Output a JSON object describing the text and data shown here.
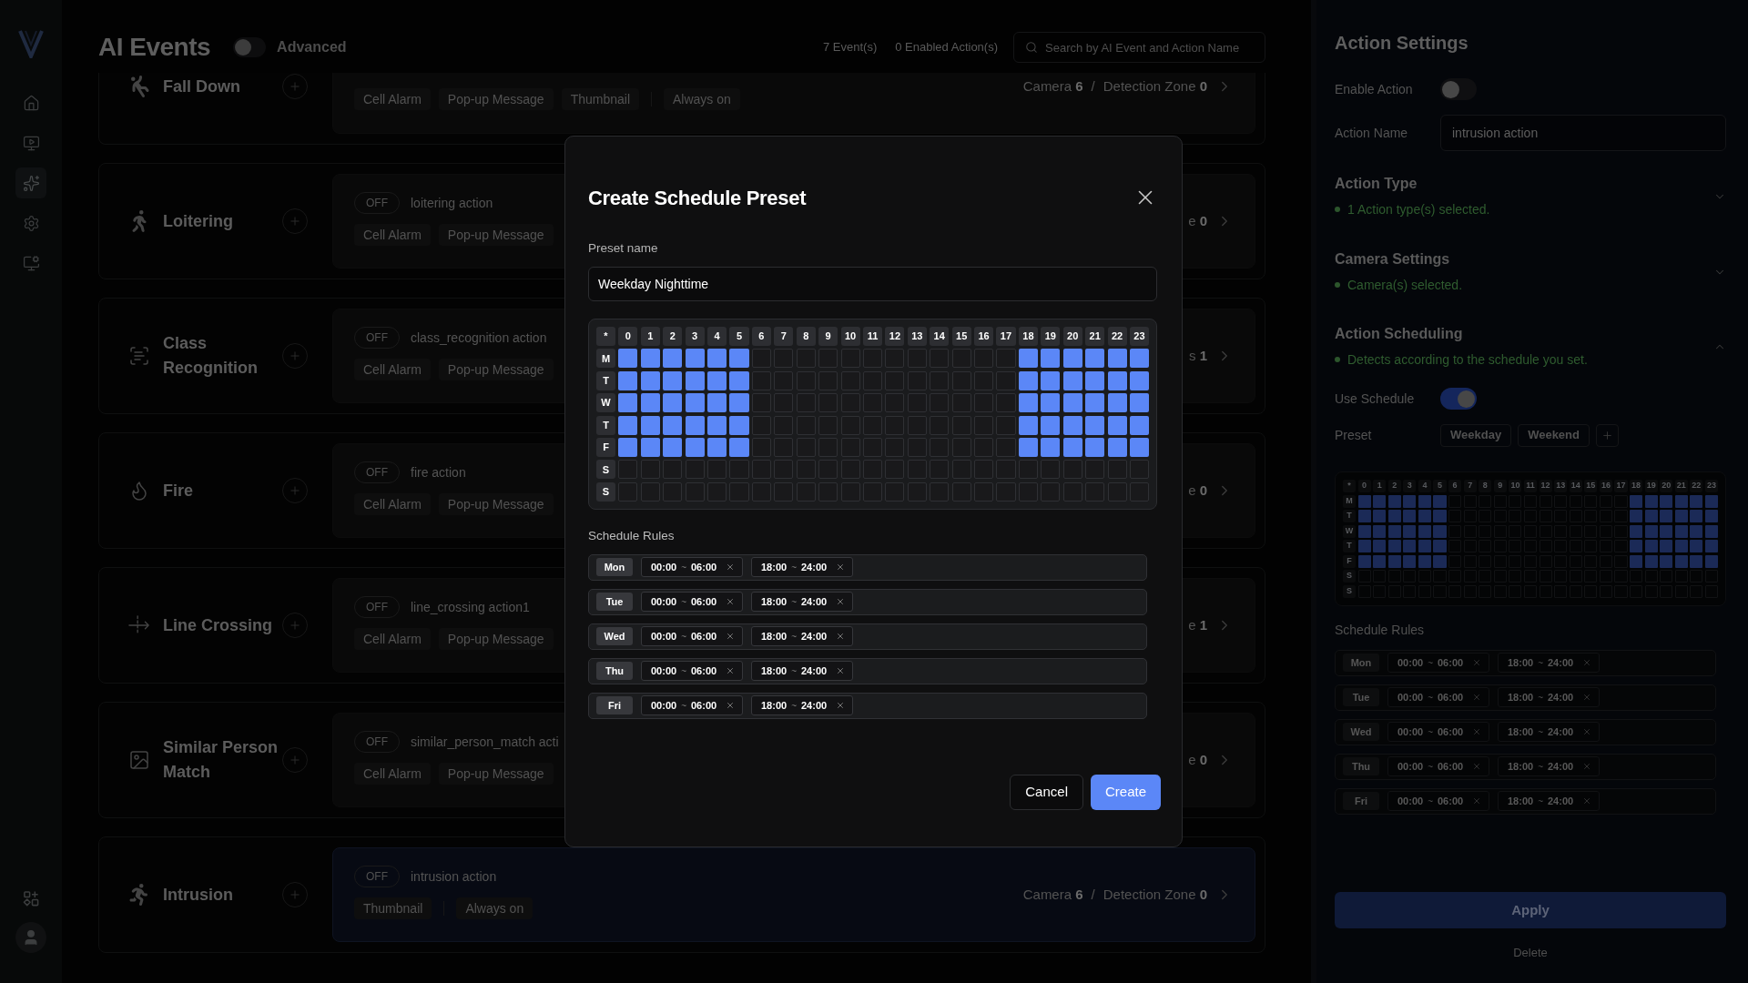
{
  "sidebar": {
    "nav": [
      {
        "selected": false
      },
      {
        "selected": false
      },
      {
        "selected": true
      },
      {
        "selected": false
      },
      {
        "selected": false
      }
    ]
  },
  "header": {
    "title": "AI Events",
    "advanced": {
      "label": "Advanced",
      "on": false
    },
    "event_count": "7 Event(s)",
    "enabled_count": "0 Enabled Action(s)",
    "search": {
      "placeholder": "Search by AI Event and Action Name"
    }
  },
  "events": [
    {
      "name": "Fall Down",
      "action": {
        "selected": false,
        "chips": [
          "Cell Alarm",
          "Pop-up Message",
          "Thumbnail"
        ],
        "schedule": "Always on",
        "summary": [
          "Camera **6**",
          "/",
          "Detection Zone **0**"
        ]
      }
    },
    {
      "name": "Loitering",
      "action": {
        "selected": false,
        "status": "OFF",
        "name": "loitering action",
        "chips": [
          "Cell Alarm",
          "Pop-up Message"
        ],
        "summary": [
          "e **0**"
        ]
      }
    },
    {
      "name": "Class Recognition",
      "action": {
        "selected": false,
        "status": "OFF",
        "name": "class_recognition action",
        "chips": [
          "Cell Alarm",
          "Pop-up Message"
        ],
        "summary": [
          "s **1**"
        ]
      }
    },
    {
      "name": "Fire",
      "action": {
        "selected": false,
        "status": "OFF",
        "name": "fire action",
        "chips": [
          "Cell Alarm",
          "Pop-up Message"
        ],
        "summary": [
          "e **0**"
        ]
      }
    },
    {
      "name": "Line Crossing",
      "action": {
        "selected": false,
        "status": "OFF",
        "name": "line_crossing action1",
        "chips": [
          "Cell Alarm",
          "Pop-up Message"
        ],
        "summary": [
          "e **1**"
        ]
      }
    },
    {
      "name": "Similar Person Match",
      "action": {
        "selected": false,
        "status": "OFF",
        "name": "similar_person_match acti",
        "chips": [
          "Cell Alarm",
          "Pop-up Message"
        ],
        "summary": [
          "e **0**"
        ]
      }
    },
    {
      "name": "Intrusion",
      "action": {
        "selected": true,
        "status": "OFF",
        "name": "intrusion action",
        "chips": [
          "Thumbnail"
        ],
        "schedule": "Always on",
        "summary": [
          "Camera **6**",
          "/",
          "Detection Zone **0**"
        ]
      }
    }
  ],
  "settings": {
    "title": "Action Settings",
    "enable_action": {
      "label": "Enable Action",
      "on": false
    },
    "action_name": {
      "label": "Action Name",
      "value": "intrusion action"
    },
    "sections": [
      {
        "title": "Action Type",
        "status": "1 Action type(s) selected.",
        "expanded": false
      },
      {
        "title": "Camera Settings",
        "status": "Camera(s) selected.",
        "expanded": false
      },
      {
        "title": "Action Scheduling",
        "status": "Detects according to the schedule you set.",
        "expanded": true,
        "use_schedule": {
          "label": "Use Schedule",
          "on": true
        },
        "preset": {
          "label": "Preset",
          "options": [
            "Weekday",
            "Weekend"
          ]
        },
        "grid": {
          "corner": "*",
          "hours": [
            "0",
            "1",
            "2",
            "3",
            "4",
            "5",
            "6",
            "7",
            "8",
            "9",
            "10",
            "11",
            "12",
            "13",
            "14",
            "15",
            "16",
            "17",
            "18",
            "19",
            "20",
            "21",
            "22",
            "23"
          ],
          "rows": [
            {
              "day": "M",
              "cells": [
                true,
                true,
                true,
                true,
                true,
                true,
                false,
                false,
                false,
                false,
                false,
                false,
                false,
                false,
                false,
                false,
                false,
                false,
                true,
                true,
                true,
                true,
                true,
                true
              ]
            },
            {
              "day": "T",
              "cells": [
                true,
                true,
                true,
                true,
                true,
                true,
                false,
                false,
                false,
                false,
                false,
                false,
                false,
                false,
                false,
                false,
                false,
                false,
                true,
                true,
                true,
                true,
                true,
                true
              ]
            },
            {
              "day": "W",
              "cells": [
                true,
                true,
                true,
                true,
                true,
                true,
                false,
                false,
                false,
                false,
                false,
                false,
                false,
                false,
                false,
                false,
                false,
                false,
                true,
                true,
                true,
                true,
                true,
                true
              ]
            },
            {
              "day": "T",
              "cells": [
                true,
                true,
                true,
                true,
                true,
                true,
                false,
                false,
                false,
                false,
                false,
                false,
                false,
                false,
                false,
                false,
                false,
                false,
                true,
                true,
                true,
                true,
                true,
                true
              ]
            },
            {
              "day": "F",
              "cells": [
                true,
                true,
                true,
                true,
                true,
                true,
                false,
                false,
                false,
                false,
                false,
                false,
                false,
                false,
                false,
                false,
                false,
                false,
                true,
                true,
                true,
                true,
                true,
                true
              ]
            },
            {
              "day": "S",
              "cells": [
                false,
                false,
                false,
                false,
                false,
                false,
                false,
                false,
                false,
                false,
                false,
                false,
                false,
                false,
                false,
                false,
                false,
                false,
                false,
                false,
                false,
                false,
                false,
                false
              ]
            },
            {
              "day": "S",
              "cells": [
                false,
                false,
                false,
                false,
                false,
                false,
                false,
                false,
                false,
                false,
                false,
                false,
                false,
                false,
                false,
                false,
                false,
                false,
                false,
                false,
                false,
                false,
                false,
                false
              ]
            }
          ]
        },
        "rules_label": "Schedule Rules",
        "rules": [
          {
            "day": "Mon",
            "ranges": [
              {
                "start": "00:00",
                "separator": "~",
                "end": "06:00"
              },
              {
                "start": "18:00",
                "separator": "~",
                "end": "24:00"
              }
            ]
          },
          {
            "day": "Tue",
            "ranges": [
              {
                "start": "00:00",
                "separator": "~",
                "end": "06:00"
              },
              {
                "start": "18:00",
                "separator": "~",
                "end": "24:00"
              }
            ]
          },
          {
            "day": "Wed",
            "ranges": [
              {
                "start": "00:00",
                "separator": "~",
                "end": "06:00"
              },
              {
                "start": "18:00",
                "separator": "~",
                "end": "24:00"
              }
            ]
          },
          {
            "day": "Thu",
            "ranges": [
              {
                "start": "00:00",
                "separator": "~",
                "end": "06:00"
              },
              {
                "start": "18:00",
                "separator": "~",
                "end": "24:00"
              }
            ]
          },
          {
            "day": "Fri",
            "ranges": [
              {
                "start": "00:00",
                "separator": "~",
                "end": "06:00"
              },
              {
                "start": "18:00",
                "separator": "~",
                "end": "24:00"
              }
            ]
          }
        ]
      }
    ],
    "apply": "Apply",
    "delete": "Delete"
  },
  "modal": {
    "title": "Create Schedule Preset",
    "preset": {
      "label": "Preset name",
      "value": "Weekday Nighttime"
    },
    "grid": {
      "corner": "*",
      "hours": [
        "0",
        "1",
        "2",
        "3",
        "4",
        "5",
        "6",
        "7",
        "8",
        "9",
        "10",
        "11",
        "12",
        "13",
        "14",
        "15",
        "16",
        "17",
        "18",
        "19",
        "20",
        "21",
        "22",
        "23"
      ],
      "rows": [
        {
          "day": "M",
          "cells": [
            true,
            true,
            true,
            true,
            true,
            true,
            false,
            false,
            false,
            false,
            false,
            false,
            false,
            false,
            false,
            false,
            false,
            false,
            true,
            true,
            true,
            true,
            true,
            true
          ]
        },
        {
          "day": "T",
          "cells": [
            true,
            true,
            true,
            true,
            true,
            true,
            false,
            false,
            false,
            false,
            false,
            false,
            false,
            false,
            false,
            false,
            false,
            false,
            true,
            true,
            true,
            true,
            true,
            true
          ]
        },
        {
          "day": "W",
          "cells": [
            true,
            true,
            true,
            true,
            true,
            true,
            false,
            false,
            false,
            false,
            false,
            false,
            false,
            false,
            false,
            false,
            false,
            false,
            true,
            true,
            true,
            true,
            true,
            true
          ]
        },
        {
          "day": "T",
          "cells": [
            true,
            true,
            true,
            true,
            true,
            true,
            false,
            false,
            false,
            false,
            false,
            false,
            false,
            false,
            false,
            false,
            false,
            false,
            true,
            true,
            true,
            true,
            true,
            true
          ]
        },
        {
          "day": "F",
          "cells": [
            true,
            true,
            true,
            true,
            true,
            true,
            false,
            false,
            false,
            false,
            false,
            false,
            false,
            false,
            false,
            false,
            false,
            false,
            true,
            true,
            true,
            true,
            true,
            true
          ]
        },
        {
          "day": "S",
          "cells": [
            false,
            false,
            false,
            false,
            false,
            false,
            false,
            false,
            false,
            false,
            false,
            false,
            false,
            false,
            false,
            false,
            false,
            false,
            false,
            false,
            false,
            false,
            false,
            false
          ]
        },
        {
          "day": "S",
          "cells": [
            false,
            false,
            false,
            false,
            false,
            false,
            false,
            false,
            false,
            false,
            false,
            false,
            false,
            false,
            false,
            false,
            false,
            false,
            false,
            false,
            false,
            false,
            false,
            false
          ]
        }
      ]
    },
    "rules_label": "Schedule Rules",
    "rules": [
      {
        "day": "Mon",
        "ranges": [
          {
            "start": "00:00",
            "separator": "~",
            "end": "06:00"
          },
          {
            "start": "18:00",
            "separator": "~",
            "end": "24:00"
          }
        ]
      },
      {
        "day": "Tue",
        "ranges": [
          {
            "start": "00:00",
            "separator": "~",
            "end": "06:00"
          },
          {
            "start": "18:00",
            "separator": "~",
            "end": "24:00"
          }
        ]
      },
      {
        "day": "Wed",
        "ranges": [
          {
            "start": "00:00",
            "separator": "~",
            "end": "06:00"
          },
          {
            "start": "18:00",
            "separator": "~",
            "end": "24:00"
          }
        ]
      },
      {
        "day": "Thu",
        "ranges": [
          {
            "start": "00:00",
            "separator": "~",
            "end": "06:00"
          },
          {
            "start": "18:00",
            "separator": "~",
            "end": "24:00"
          }
        ]
      },
      {
        "day": "Fri",
        "ranges": [
          {
            "start": "00:00",
            "separator": "~",
            "end": "06:00"
          },
          {
            "start": "18:00",
            "separator": "~",
            "end": "24:00"
          }
        ]
      }
    ],
    "cancel": "Cancel",
    "create": "Create"
  }
}
